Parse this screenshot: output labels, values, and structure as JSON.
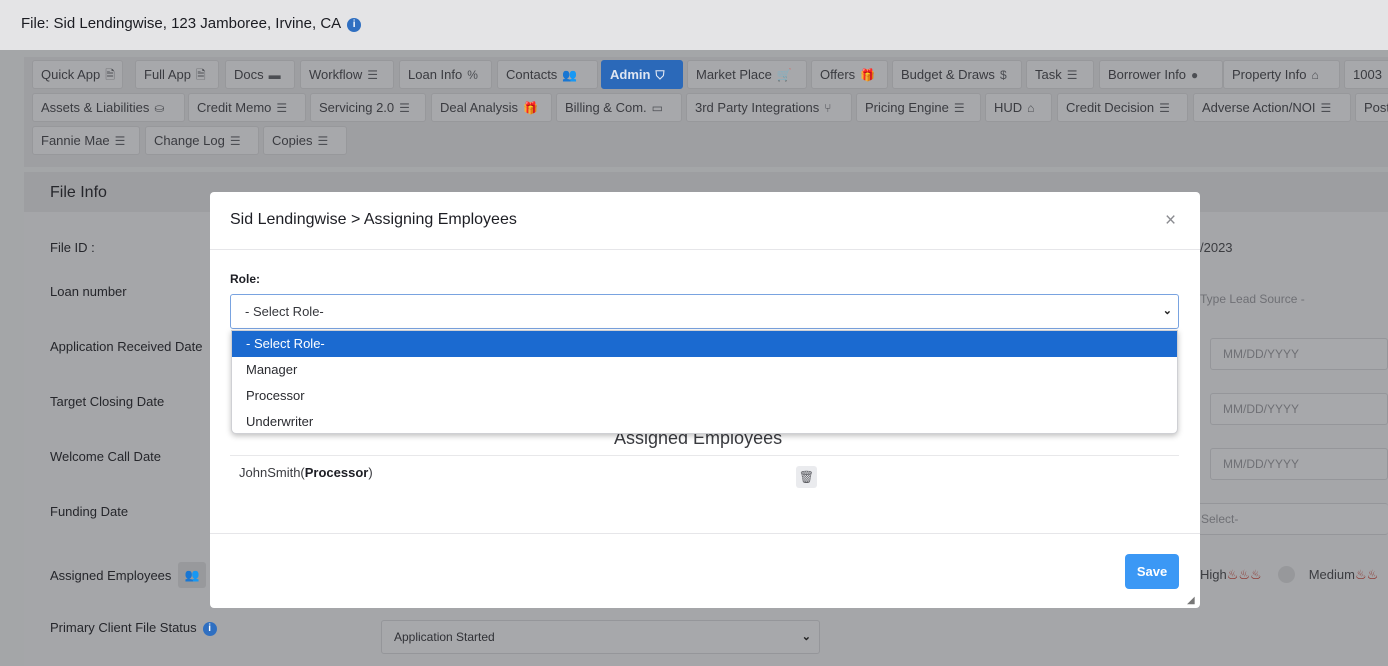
{
  "header": {
    "file_title": "File: Sid Lendingwise, 123 Jamboree, Irvine, CA",
    "info_icon": "info-icon"
  },
  "tabs": [
    {
      "label": "Quick App",
      "icon": "file-icon",
      "glyph": "🗎"
    },
    {
      "label": "Full App",
      "icon": "file-icon",
      "glyph": "🗎"
    },
    {
      "label": "Docs",
      "icon": "folder-icon",
      "glyph": "▬"
    },
    {
      "label": "Workflow",
      "icon": "list-check-icon",
      "glyph": "☰"
    },
    {
      "label": "Loan Info",
      "icon": "percent-icon",
      "glyph": "%"
    },
    {
      "label": "Contacts",
      "icon": "users-icon",
      "glyph": "👥"
    },
    {
      "label": "Admin",
      "icon": "shield-icon",
      "glyph": "⛉",
      "active": true
    },
    {
      "label": "Market Place",
      "icon": "cart-icon",
      "glyph": "🛒"
    },
    {
      "label": "Offers",
      "icon": "gift-icon",
      "glyph": "🎁"
    },
    {
      "label": "Budget & Draws",
      "icon": "dollar-icon",
      "glyph": "$"
    },
    {
      "label": "Task",
      "icon": "list-check-icon",
      "glyph": "☰"
    },
    {
      "label": "Borrower Info",
      "icon": "user-circle-icon",
      "glyph": "●"
    },
    {
      "label": "Property Info",
      "icon": "home-icon",
      "glyph": "⌂"
    },
    {
      "label": "1003",
      "icon": "",
      "glyph": ""
    },
    {
      "label": "Assets & Liabilities",
      "icon": "hand-coin-icon",
      "glyph": "⛀"
    },
    {
      "label": "Credit Memo",
      "icon": "list-icon",
      "glyph": "☰"
    },
    {
      "label": "Servicing 2.0",
      "icon": "list-icon",
      "glyph": "☰"
    },
    {
      "label": "Deal Analysis",
      "icon": "gift-icon",
      "glyph": "🎁"
    },
    {
      "label": "Billing & Com.",
      "icon": "credit-card-icon",
      "glyph": "▭"
    },
    {
      "label": "3rd Party Integrations",
      "icon": "branch-icon",
      "glyph": "⑂"
    },
    {
      "label": "Pricing Engine",
      "icon": "list-icon",
      "glyph": "☰"
    },
    {
      "label": "HUD",
      "icon": "home-icon",
      "glyph": "⌂"
    },
    {
      "label": "Credit Decision",
      "icon": "list-icon",
      "glyph": "☰"
    },
    {
      "label": "Adverse Action/NOI",
      "icon": "list-icon",
      "glyph": "☰"
    },
    {
      "label": "Post",
      "icon": "",
      "glyph": ""
    },
    {
      "label": "Fannie Mae",
      "icon": "list-icon",
      "glyph": "☰"
    },
    {
      "label": "Change Log",
      "icon": "list-icon",
      "glyph": "☰"
    },
    {
      "label": "Copies",
      "icon": "list-icon",
      "glyph": "☰"
    }
  ],
  "file_info": {
    "title": "File Info",
    "labels": {
      "file_id": "File ID :",
      "loan_number": "Loan number",
      "app_received": "Application Received Date",
      "target_closing": "Target Closing Date",
      "welcome_call": "Welcome Call Date",
      "funding": "Funding Date",
      "assigned_employees": "Assigned Employees",
      "primary_status": "Primary Client File Status"
    },
    "right_values": {
      "date_fragment": "/2023",
      "lead_source_placeholder": "Type Lead Source -",
      "date_placeholder": "MM/DD/YYYY",
      "select_fragment": "Select-",
      "priority_high": "High",
      "priority_medium": "Medium"
    },
    "primary_status_value": "Application Started"
  },
  "modal": {
    "title": "Sid Lendingwise > Assigning Employees",
    "close": "×",
    "role_label": "Role:",
    "role_selected": "- Select Role-",
    "role_options": [
      "- Select Role-",
      "Manager",
      "Processor",
      "Underwriter"
    ],
    "assigned_heading": "Assigned Employees",
    "employee_name": "JohnSmith",
    "employee_role": "Processor",
    "save_label": "Save"
  }
}
